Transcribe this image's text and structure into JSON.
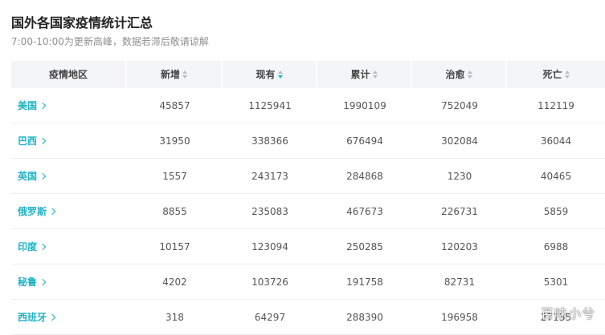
{
  "header": {
    "title": "国外各国家疫情统计汇总",
    "subtitle": "7:00-10:00为更新高峰，数据若滞后敬请谅解"
  },
  "columns": [
    {
      "label": "疫情地区",
      "sortable": false,
      "active": false
    },
    {
      "label": "新增",
      "sortable": true,
      "active": false
    },
    {
      "label": "现有",
      "sortable": true,
      "active": true
    },
    {
      "label": "累计",
      "sortable": true,
      "active": false
    },
    {
      "label": "治愈",
      "sortable": true,
      "active": false
    },
    {
      "label": "死亡",
      "sortable": true,
      "active": false
    }
  ],
  "rows": [
    {
      "region": "美国",
      "new": "45857",
      "current": "1125941",
      "total": "1990109",
      "cured": "752049",
      "deaths": "112119"
    },
    {
      "region": "巴西",
      "new": "31950",
      "current": "338366",
      "total": "676494",
      "cured": "302084",
      "deaths": "36044"
    },
    {
      "region": "英国",
      "new": "1557",
      "current": "243173",
      "total": "284868",
      "cured": "1230",
      "deaths": "40465"
    },
    {
      "region": "俄罗斯",
      "new": "8855",
      "current": "235083",
      "total": "467673",
      "cured": "226731",
      "deaths": "5859"
    },
    {
      "region": "印度",
      "new": "10157",
      "current": "123094",
      "total": "250285",
      "cured": "120203",
      "deaths": "6988"
    },
    {
      "region": "秘鲁",
      "new": "4202",
      "current": "103726",
      "total": "191758",
      "cured": "82731",
      "deaths": "5301"
    },
    {
      "region": "西班牙",
      "new": "318",
      "current": "64297",
      "total": "288390",
      "cured": "196958",
      "deaths": "27135"
    }
  ],
  "watermark": "百味小兮",
  "colors": {
    "accent": "#1fb3c5",
    "header_bg": "#f3f5f8"
  }
}
